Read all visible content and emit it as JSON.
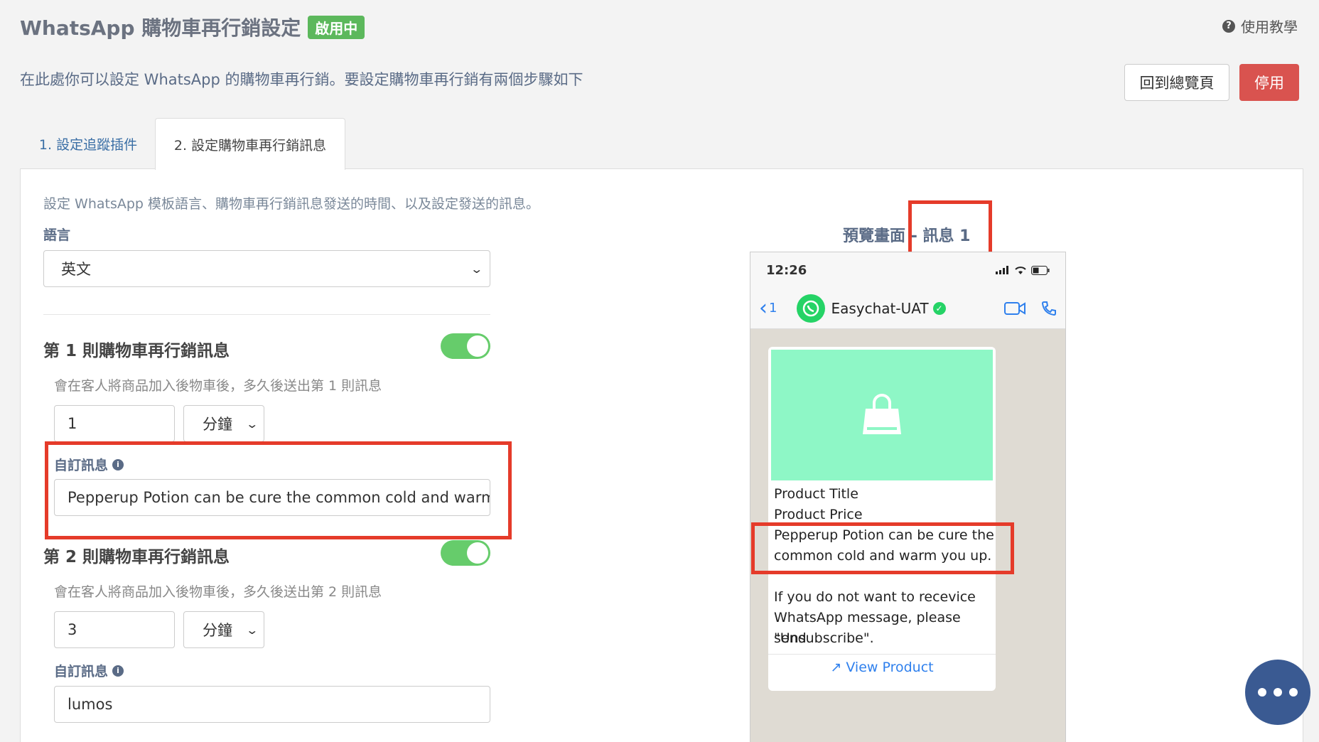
{
  "header": {
    "title": "WhatsApp 購物車再行銷設定",
    "status_badge": "啟用中",
    "help_link": "使用教學",
    "intro": "在此處你可以設定 WhatsApp 的購物車再行銷。要設定購物車再行銷有兩個步驟如下"
  },
  "actions": {
    "overview_label": "回到總覽頁",
    "disable_label": "停用",
    "disable_color": "#d9534f"
  },
  "tabs": [
    {
      "label": "1. 設定追蹤插件",
      "active": false
    },
    {
      "label": "2. 設定購物車再行銷訊息",
      "active": true
    }
  ],
  "form": {
    "description": "設定 WhatsApp 模板語言、購物車再行銷訊息發送的時間、以及設定發送的訊息。",
    "language_label": "語言",
    "language_value": "英文",
    "messages": [
      {
        "title": "第 1 則購物車再行銷訊息",
        "enabled": true,
        "hint": "會在客人將商品加入後物車後，多久後送出第 1 則訊息",
        "delay_value": "1",
        "delay_unit": "分鐘",
        "custom_label": "自訂訊息",
        "custom_value": "Pepperup Potion can be cure the common cold and warm you up."
      },
      {
        "title": "第 2 則購物車再行銷訊息",
        "enabled": true,
        "hint": "會在客人將商品加入後物車後，多久後送出第 2 則訊息",
        "delay_value": "3",
        "delay_unit": "分鐘",
        "custom_label": "自訂訊息",
        "custom_value": "lumos"
      }
    ]
  },
  "preview": {
    "title_prefix": "預覽畫面",
    "title_suffix": "- 訊息 1",
    "time": "12:26",
    "back_count": "1",
    "contact_name": "Easychat-UAT",
    "product_title": "Product Title",
    "product_price": "Product Price",
    "message_line1": "Pepperup Potion can be cure the",
    "message_line2": "common cold and warm you up.",
    "unsub_line1": "If you do not want to recevice",
    "unsub_line2": "WhatsApp message, please send",
    "unsub_line3": "\"Unsubscribe\".",
    "view_product": "View Product",
    "image_color": "#8ef7c6"
  },
  "colors": {
    "accent_green": "#5cb85c",
    "toggle_on": "#66cc6b",
    "highlight_red": "#e53b2a",
    "fab": "#3a5a92"
  }
}
